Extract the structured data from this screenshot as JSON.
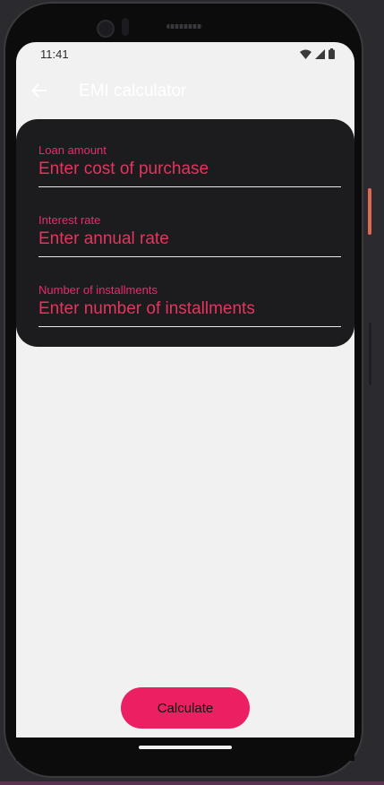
{
  "status_bar": {
    "time": "11:41"
  },
  "app_bar": {
    "title": "EMI calculator",
    "back_icon": "arrow-back-icon"
  },
  "form": {
    "loan_amount": {
      "label": "Loan amount",
      "placeholder": "Enter cost of purchase",
      "value": ""
    },
    "interest_rate": {
      "label": "Interest rate",
      "placeholder": "Enter annual rate",
      "value": ""
    },
    "installments": {
      "label": "Number of installments",
      "placeholder": "Enter number of installments",
      "value": ""
    }
  },
  "actions": {
    "calculate_label": "Calculate"
  },
  "colors": {
    "accent": "#ec1f62",
    "card_background": "#1c1b1d",
    "screen_background": "#f1f1f1"
  }
}
